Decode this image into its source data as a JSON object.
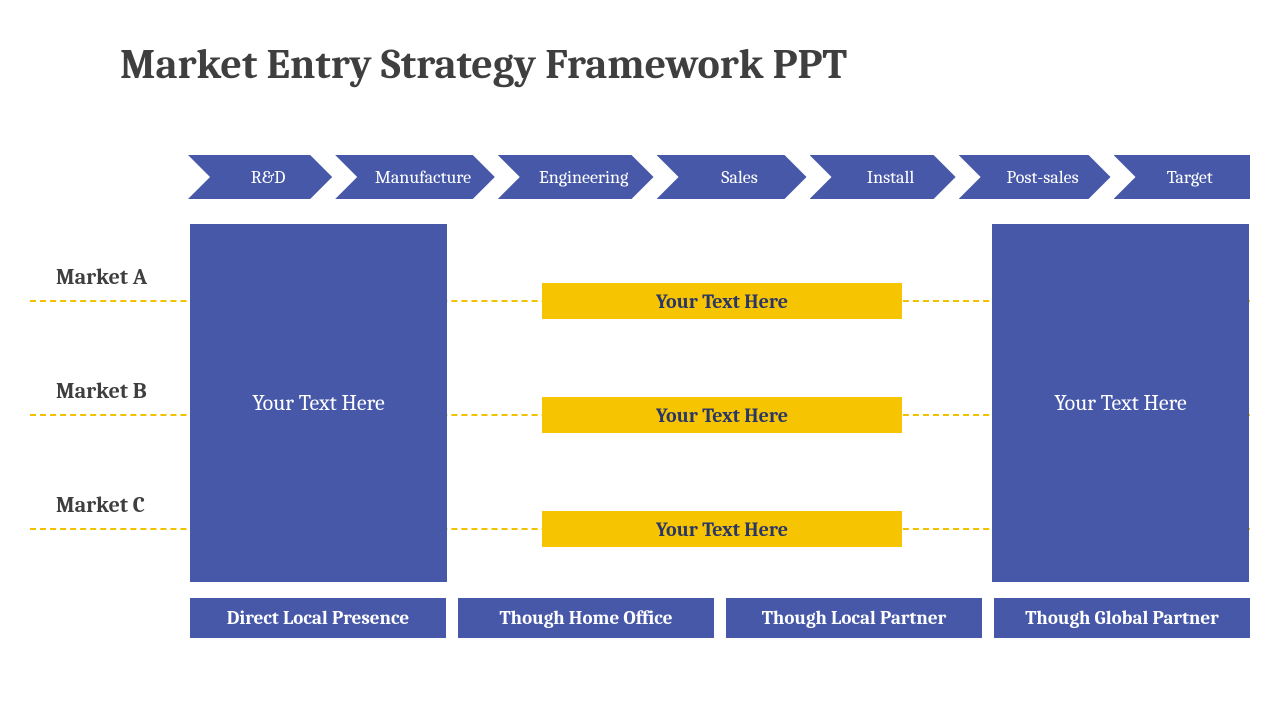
{
  "title": "Market Entry Strategy Framework PPT",
  "chevrons": [
    "R&D",
    "Manufacture",
    "Engineering",
    "Sales",
    "Install",
    "Post-sales",
    "Target"
  ],
  "markets": {
    "a": "Market A",
    "b": "Market B",
    "c": "Market C"
  },
  "left_block": "Your Text Here",
  "right_block": "Your Text Here",
  "yellow": {
    "a": "Your Text Here",
    "b": "Your Text Here",
    "c": "Your Text Here"
  },
  "bottom": [
    "Direct Local Presence",
    "Though Home Office",
    "Though Local Partner",
    "Though Global Partner"
  ],
  "colors": {
    "primary": "#4758a8",
    "accent": "#f6c400",
    "text": "#3f3f3f"
  }
}
